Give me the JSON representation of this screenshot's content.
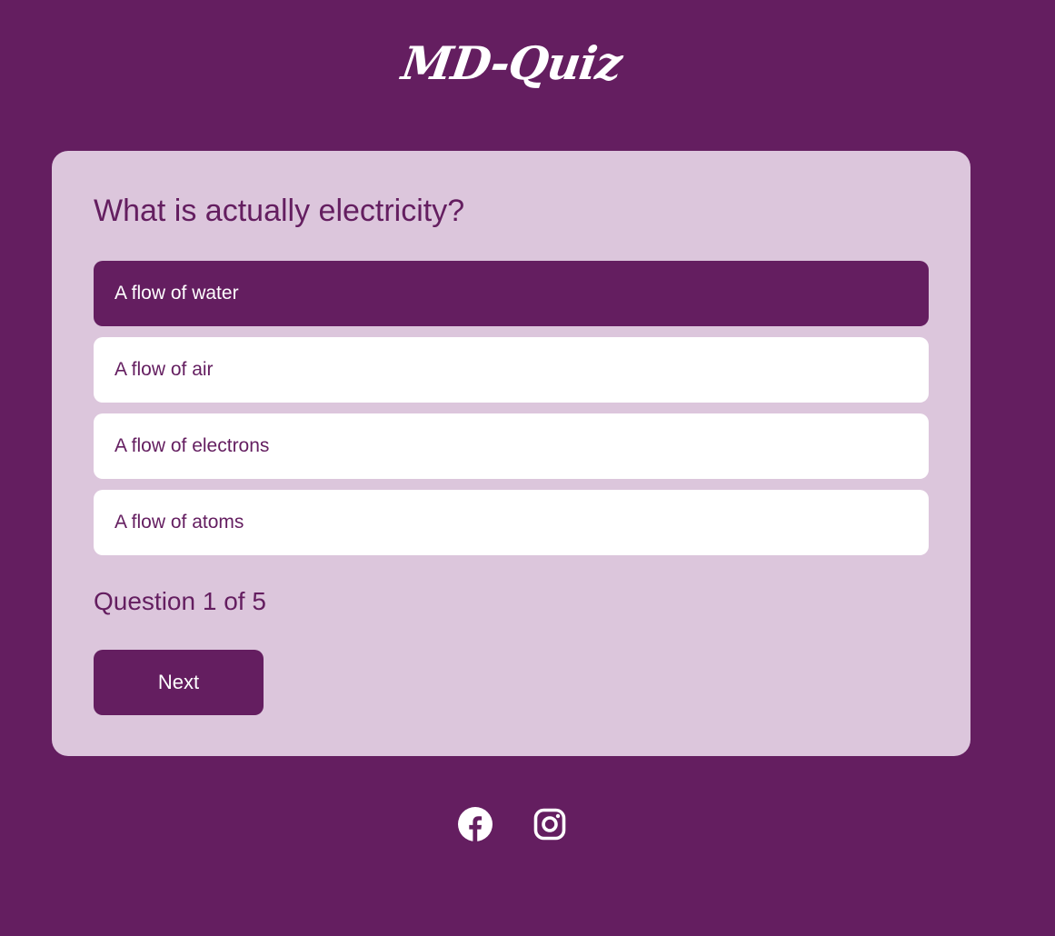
{
  "header": {
    "title": "MD-Quiz"
  },
  "quiz": {
    "question": "What is actually electricity?",
    "answers": [
      {
        "label": "A flow of water",
        "selected": true
      },
      {
        "label": "A flow of air",
        "selected": false
      },
      {
        "label": "A flow of electrons",
        "selected": false
      },
      {
        "label": "A flow of atoms",
        "selected": false
      }
    ],
    "progress": "Question 1 of 5",
    "next_label": "Next"
  },
  "footer": {
    "icons": [
      "facebook-icon",
      "instagram-icon"
    ]
  },
  "colors": {
    "primary": "#641e60",
    "card_background": "#dcc6dc",
    "answer_background": "#ffffff",
    "text_light": "#ffffff"
  }
}
